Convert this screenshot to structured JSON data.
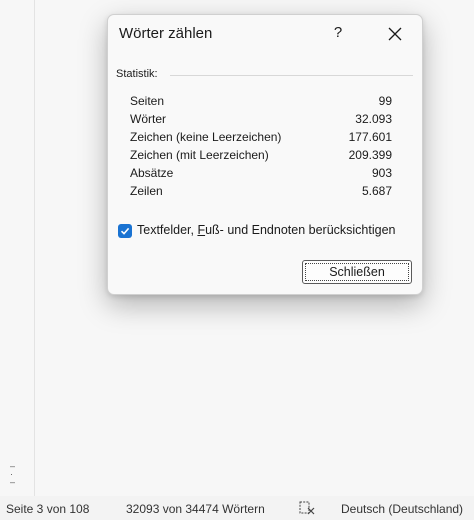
{
  "dialog": {
    "title": "Wörter zählen",
    "help_label": "?",
    "section_label": "Statistik:",
    "stats": [
      {
        "label": "Seiten",
        "value": "99"
      },
      {
        "label": "Wörter",
        "value": "32.093"
      },
      {
        "label": "Zeichen (keine Leerzeichen)",
        "value": "177.601"
      },
      {
        "label": "Zeichen (mit Leerzeichen)",
        "value": "209.399"
      },
      {
        "label": "Absätze",
        "value": "903"
      },
      {
        "label": "Zeilen",
        "value": "5.687"
      }
    ],
    "checkbox": {
      "checked": true,
      "label_pre": "Textfelder, ",
      "label_ul": "F",
      "label_post": "uß- und Endnoten berücksichtigen"
    },
    "close_button_label": "Schließen"
  },
  "statusbar": {
    "page": "Seite 3 von 108",
    "words": "32093 von 34474 Wörtern",
    "language": "Deutsch (Deutschland)"
  },
  "icons": {
    "close": "close-icon",
    "check": "checkmark-icon",
    "proofing": "proofing-icon"
  },
  "colors": {
    "checkbox_accent": "#1a73d2"
  }
}
